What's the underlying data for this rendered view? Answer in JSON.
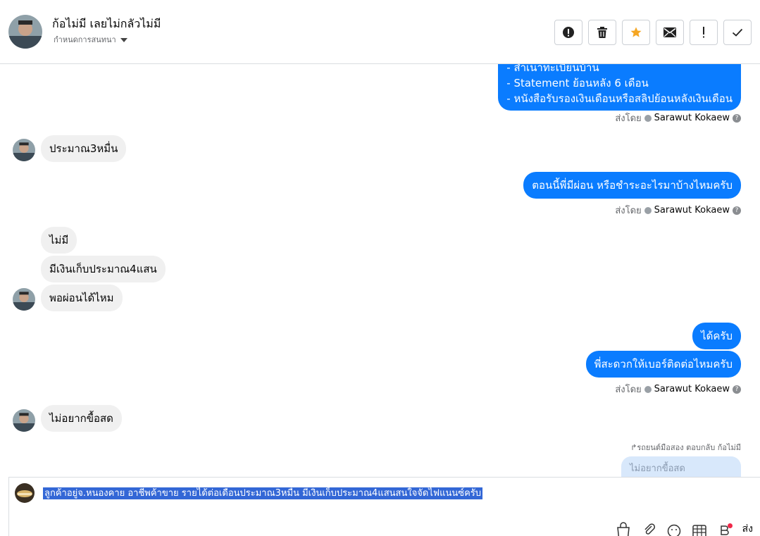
{
  "header": {
    "name": "ก้อไม่มี เลยไม่กลัวไม่มี",
    "subtitle": "กำหนดการสนทนา",
    "toolbar": [
      "spam-icon",
      "trash-icon",
      "star-icon",
      "mail-icon",
      "important-icon",
      "check-icon"
    ],
    "star_color": "#f5a623"
  },
  "messages": {
    "m0_line1": "- สำเนาทะเบียนบ้าน",
    "m0_line2": "- Statement ย้อนหลัง 6 เดือน",
    "m0_line3": "- หนังสือรับรองเงินเดือนหรือสลิปย้อนหลังเงินเดือน",
    "sent_by_label": "ส่งโดย",
    "sender": "Sarawut Kokaew",
    "help": "?",
    "in1": "ประมาณ3หมื่น",
    "out1": "ตอนนี้พี่มีผ่อน หรือชำระอะไรมาบ้างไหมครับ",
    "in2": "ไม่มี",
    "in3": "มีเงินเก็บประมาณ4แสน",
    "in4": "พอผ่อนได้ไหม",
    "out2": "ได้ครับ",
    "out3": "พี่สะดวกให้เบอร์ติดต่อไหมครับ",
    "in5": "ไม่อยากขื้อสด",
    "reply_hint": "รถยนต์มือสอง ตอบกลับ ก้อไม่มี",
    "reply_preview": "ไม่อยากขื้อสด"
  },
  "composer": {
    "text": "ลูกค้าอยู่จ.หนองคาย  อาชีพค้าขาย รายได้ต่อเดือนประมาณ3หมื่น มีเงินเก็บประมาณ4แสนสนใจจัดไฟแนนซ์ครับ",
    "send_label": "ส่ง",
    "tools": [
      "bag-icon",
      "attach-icon",
      "emoji-icon",
      "grid-icon",
      "template-icon"
    ],
    "accent": "#0a7cff",
    "selection_color": "#3367d6"
  }
}
